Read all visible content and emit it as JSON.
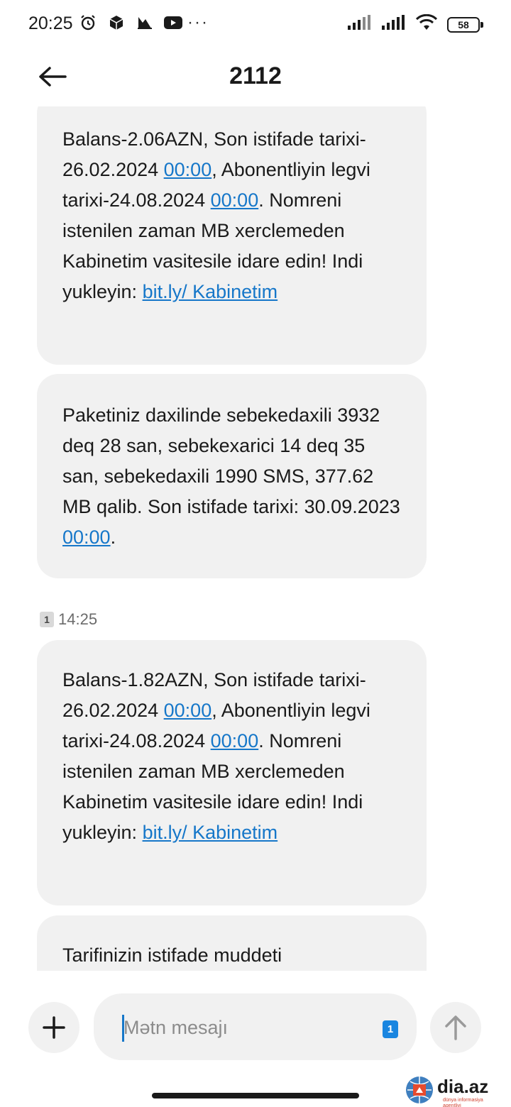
{
  "status_bar": {
    "time": "20:25",
    "dots": "···",
    "battery": "58"
  },
  "header": {
    "title": "2112"
  },
  "messages": [
    {
      "parts": [
        {
          "t": "Balans-2.06AZN, Son istifade tarixi-26.02.2024 "
        },
        {
          "t": "00:00",
          "link": true
        },
        {
          "t": ", Abonentliyin legvi tarixi-24.08.2024 "
        },
        {
          "t": "00:00",
          "link": true
        },
        {
          "t": ". Nomreni istenilen zaman MB xerclemeden Kabinetim vasitesile idare edin! Indi yukleyin: "
        },
        {
          "t": "bit.ly/ Kabinetim",
          "link": true
        }
      ]
    },
    {
      "parts": [
        {
          "t": "Paketiniz daxilinde sebekedaxili 3932 deq 28 san, sebekexarici 14 deq 35 san, sebekedaxili 1990 SMS, 377.62 MB qalib. Son istifade tarixi: 30.09.2023 "
        },
        {
          "t": "00:00",
          "link": true
        },
        {
          "t": "."
        }
      ]
    },
    {
      "parts": [
        {
          "t": "Balans-1.82AZN, Son istifade tarixi-26.02.2024 "
        },
        {
          "t": "00:00",
          "link": true
        },
        {
          "t": ", Abonentliyin legvi tarixi-24.08.2024 "
        },
        {
          "t": "00:00",
          "link": true
        },
        {
          "t": ". Nomreni istenilen zaman MB xerclemeden Kabinetim vasitesile idare edin! Indi yukleyin: "
        },
        {
          "t": "bit.ly/ Kabinetim",
          "link": true
        }
      ]
    },
    {
      "parts": [
        {
          "t": "Tarifinizin istifade muddeti"
        }
      ]
    }
  ],
  "timestamp": {
    "sim": "1",
    "time": "14:25"
  },
  "composer": {
    "placeholder": "Mətn mesajı",
    "sim": "1"
  },
  "watermark": {
    "brand": "dia.az",
    "tagline": "dünya informasiya agentliyi"
  },
  "colors": {
    "link": "#1677c9",
    "bubble": "#f1f1f1",
    "sim_badge_active": "#1a86e0"
  }
}
